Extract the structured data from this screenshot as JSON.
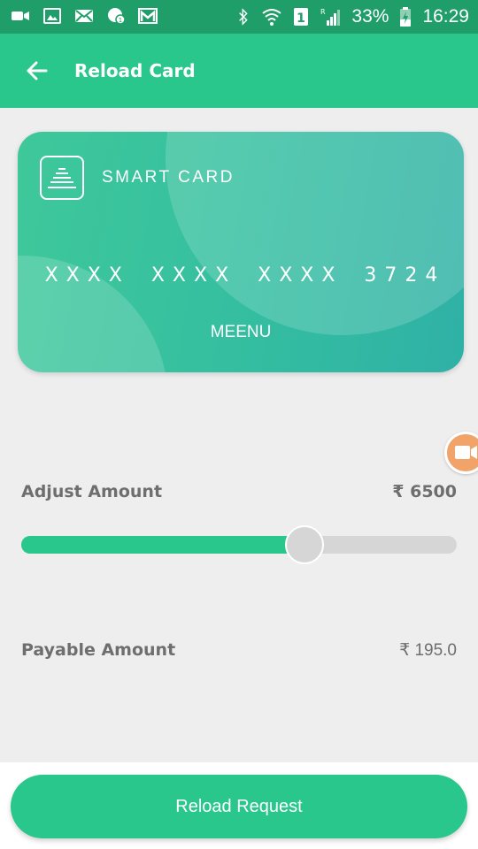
{
  "status_bar": {
    "battery": "33%",
    "time": "16:29",
    "left_icons": [
      "video-icon",
      "image-icon",
      "mail-icon",
      "messenger-icon",
      "gmail-icon"
    ],
    "right_icons": [
      "bluetooth-icon",
      "wifi-icon",
      "sim-icon",
      "signal-icon",
      "battery-icon"
    ]
  },
  "app_bar": {
    "title": "Reload Card"
  },
  "card": {
    "brand": "SMART CARD",
    "number": "XXXX XXXX XXXX 3724",
    "holder": "MEENU"
  },
  "adjust": {
    "label": "Adjust Amount",
    "value": "₹ 6500",
    "slider_fraction": 0.65
  },
  "payable": {
    "label": "Payable Amount",
    "value": "₹ 195.0"
  },
  "actions": {
    "reload_label": "Reload Request"
  },
  "colors": {
    "primary": "#29c78c",
    "status_bar": "#1f9e69",
    "text_muted": "#6e6e6e"
  }
}
